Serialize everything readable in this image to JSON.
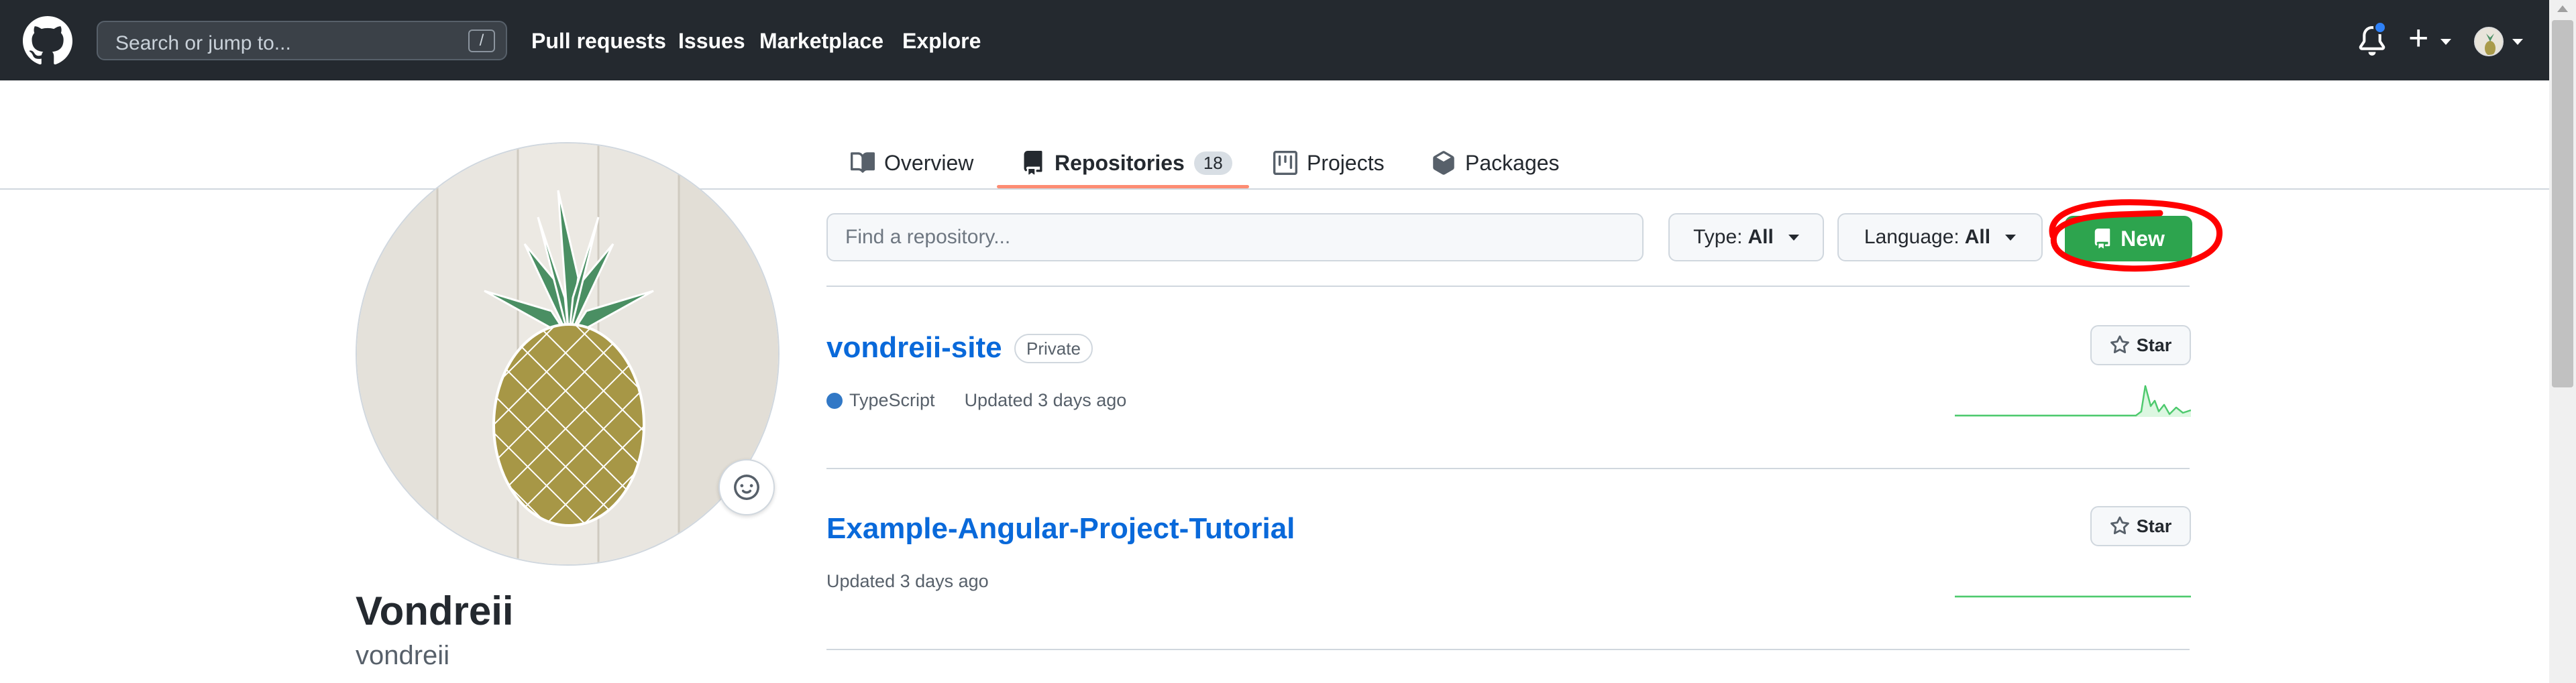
{
  "header": {
    "search_placeholder": "Search or jump to...",
    "search_shortcut": "/",
    "nav": [
      "Pull requests",
      "Issues",
      "Marketplace",
      "Explore"
    ],
    "icons": [
      "github-logo-icon",
      "bell-icon",
      "plus-icon",
      "avatar"
    ]
  },
  "tabs": [
    {
      "label": "Overview",
      "icon": "book-icon"
    },
    {
      "label": "Repositories",
      "icon": "repo-icon",
      "count": "18",
      "active": true
    },
    {
      "label": "Projects",
      "icon": "project-icon"
    },
    {
      "label": "Packages",
      "icon": "package-icon"
    }
  ],
  "profile": {
    "name": "Vondreii",
    "login": "vondreii"
  },
  "filters": {
    "find_placeholder": "Find a repository...",
    "type_label": "Type:",
    "type_value": "All",
    "language_label": "Language:",
    "language_value": "All",
    "new_label": "New"
  },
  "repos": [
    {
      "name": "vondreii-site",
      "visibility": "Private",
      "language": "TypeScript",
      "updated": "Updated 3 days ago",
      "star_label": "Star"
    },
    {
      "name": "Example-Angular-Project-Tutorial",
      "updated": "Updated 3 days ago",
      "star_label": "Star"
    }
  ],
  "colors": {
    "header_bg": "#24292f",
    "link_blue": "#0969da",
    "primary_green": "#2da44e",
    "tab_underline": "#fd8c73",
    "annotation_red": "#ff0000",
    "typescript_dot": "#3178c6"
  }
}
